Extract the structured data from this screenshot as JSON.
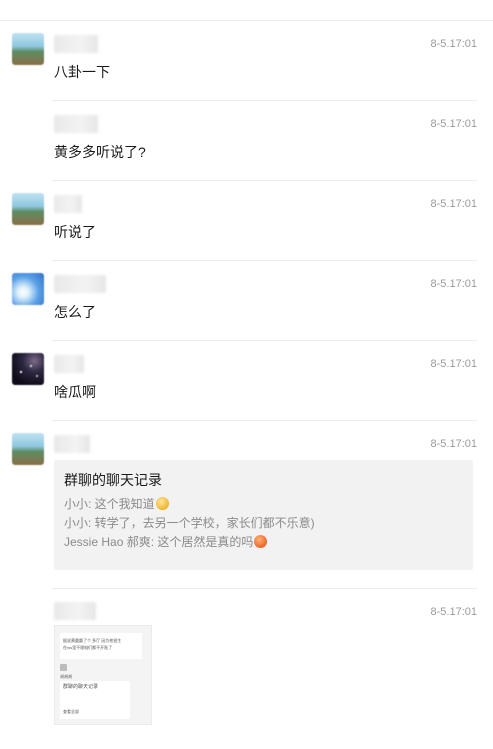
{
  "messages": [
    {
      "time": "8-5.17:01",
      "text": "八卦一下"
    },
    {
      "time": "8-5.17:01",
      "text": "黄多多听说了?"
    },
    {
      "time": "8-5.17:01",
      "text": "听说了"
    },
    {
      "time": "8-5.17:01",
      "text": "怎么了"
    },
    {
      "time": "8-5.17:01",
      "text": "啥瓜啊"
    },
    {
      "time": "8-5.17:01",
      "text": ""
    },
    {
      "time": "8-5.17:01",
      "text": ""
    }
  ],
  "forwarded_card": {
    "title": "群聊的聊天记录",
    "lines": [
      {
        "text": "小小: 这个我知道",
        "emoji": "smiling-face-icon"
      },
      {
        "text": "小小: 转学了，去另一个学校，家长们都不乐意)",
        "emoji": ""
      },
      {
        "text": "Jessie Hao 郝爽: 这个居然是真的吗",
        "emoji": "surprised-face-icon"
      }
    ]
  },
  "thumbnail": {
    "line1": "据说黄圆圆了个 多厅 因为他很生",
    "line2": "在ins里不理咱们都不开贴了",
    "reply": "胡胡胡",
    "card_title": "群聊的聊天记录",
    "card_line": "查看全部"
  },
  "colors": {
    "accent_text": "#1a1a1a",
    "muted": "#9a9a9a",
    "card_bg": "#f2f2f2"
  }
}
